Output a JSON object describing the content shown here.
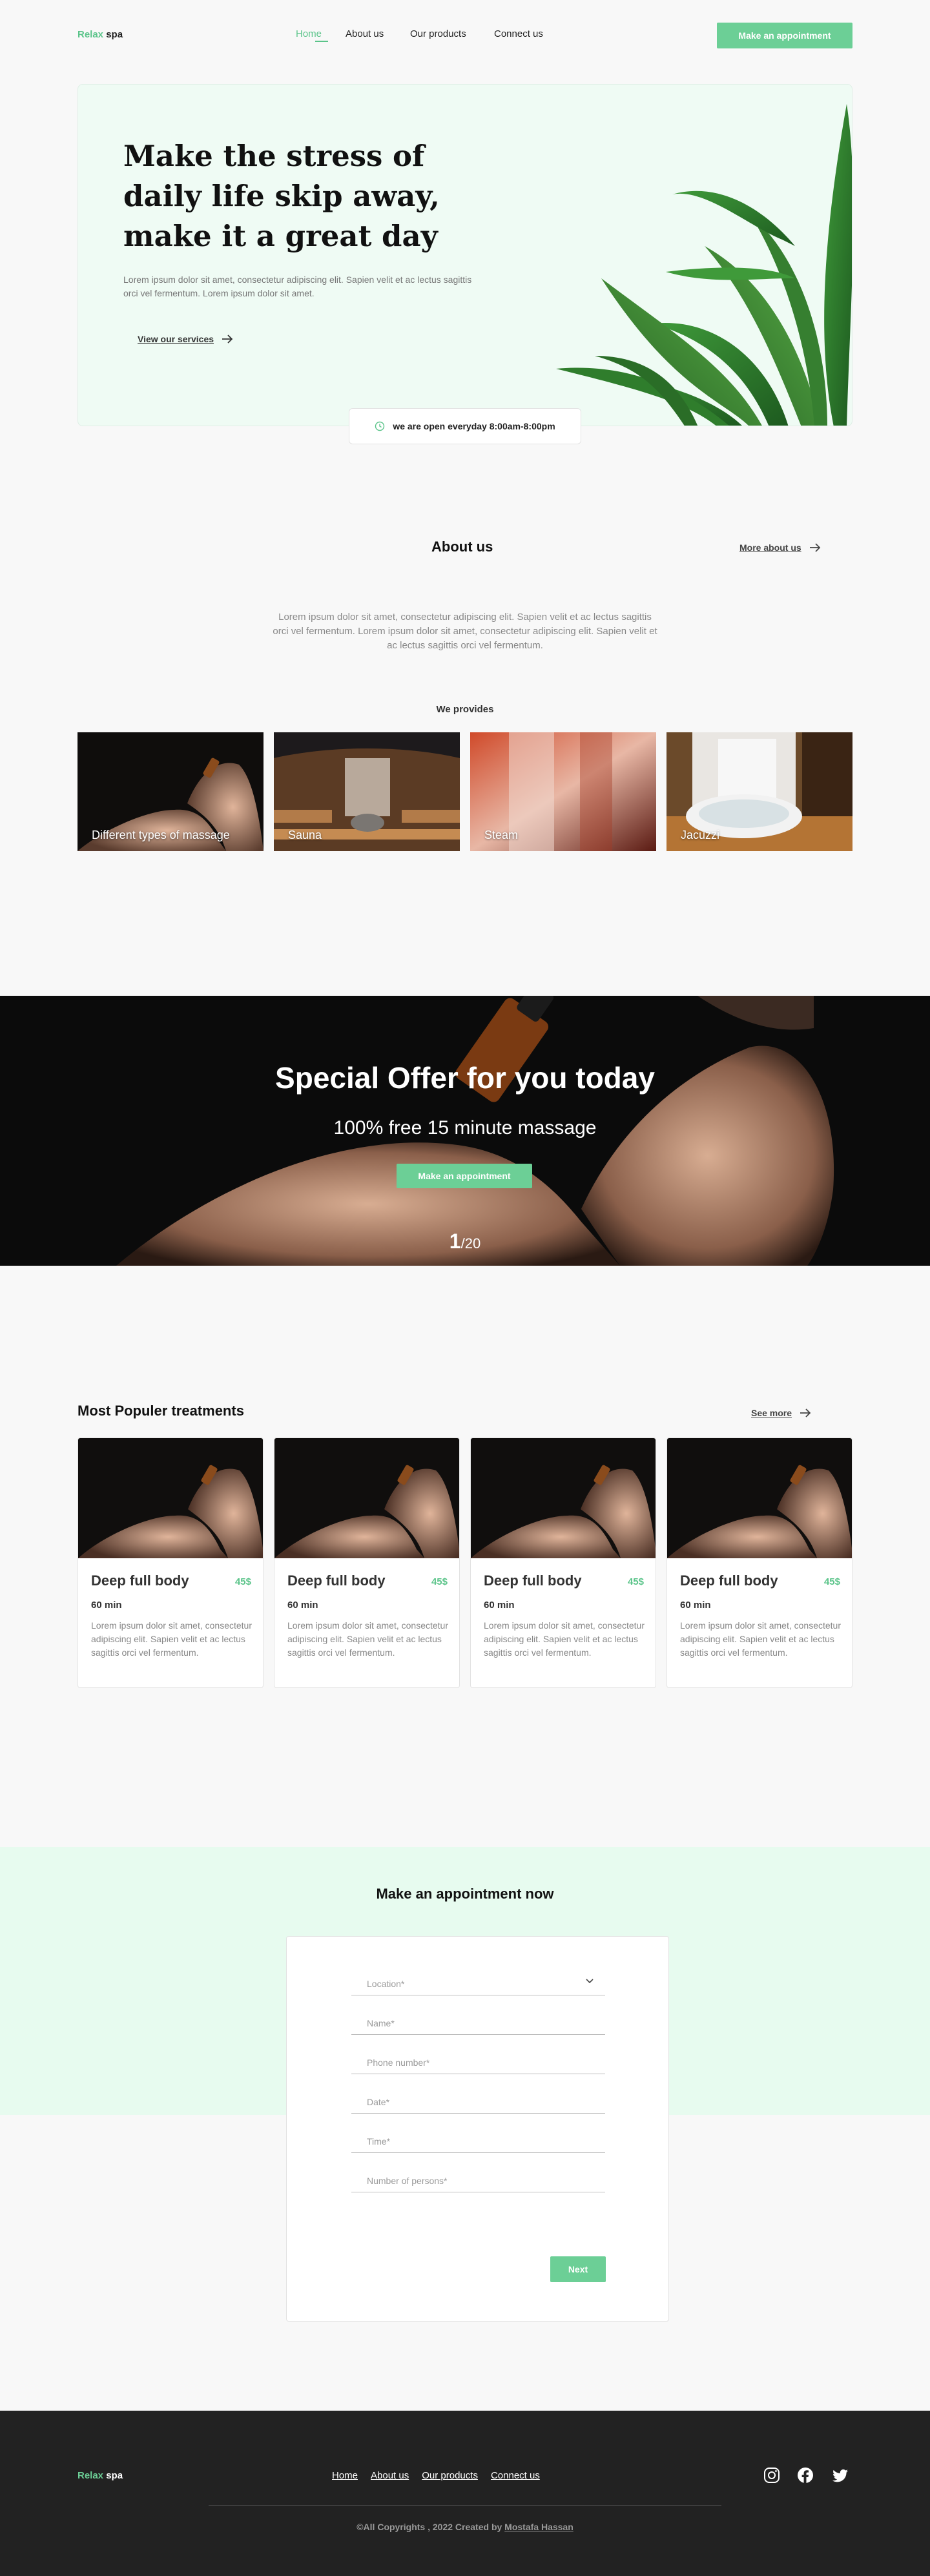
{
  "brand": {
    "accent": "Relax",
    "name": " spa",
    "accent_color": "#5bc48a"
  },
  "nav": {
    "items": [
      {
        "label": "Home",
        "active": true
      },
      {
        "label": "About us"
      },
      {
        "label": "Our products"
      },
      {
        "label": "Connect us"
      }
    ],
    "cta": "Make an appointment"
  },
  "hero": {
    "title": "Make the stress of daily life skip away, make it a great day",
    "text": "Lorem ipsum dolor sit amet, consectetur adipiscing elit. Sapien velit et ac lectus sagittis orci vel fermentum. Lorem ipsum dolor sit amet.",
    "link": "View our services",
    "hours": "we are open everyday 8:00am-8:00pm"
  },
  "about": {
    "title": "About us",
    "more": "More about us",
    "text": "Lorem ipsum dolor sit amet, consectetur adipiscing elit. Sapien velit et ac lectus sagittis orci vel fermentum. Lorem ipsum dolor sit amet, consectetur adipiscing elit. Sapien velit et ac lectus sagittis orci vel fermentum.",
    "provides_title": "We provides",
    "services": [
      {
        "label": "Different types of massage"
      },
      {
        "label": "Sauna"
      },
      {
        "label": "Steam"
      },
      {
        "label": "Jacuzzi"
      }
    ]
  },
  "offer": {
    "title": "Special Offer for you today",
    "subtitle": "100% free 15 minute massage",
    "cta": "Make an appointment",
    "page_current": "1",
    "page_total": "/20"
  },
  "treatments": {
    "title": "Most Populer treatments",
    "more": "See more",
    "cards": [
      {
        "name": "Deep full body",
        "price": "45$",
        "duration": "60 min",
        "desc": "Lorem ipsum dolor sit amet, consectetur adipiscing elit. Sapien velit et ac lectus sagittis orci vel fermentum."
      },
      {
        "name": "Deep full body",
        "price": "45$",
        "duration": "60 min",
        "desc": "Lorem ipsum dolor sit amet, consectetur adipiscing elit. Sapien velit et ac lectus sagittis orci vel fermentum."
      },
      {
        "name": "Deep full body",
        "price": "45$",
        "duration": "60 min",
        "desc": "Lorem ipsum dolor sit amet, consectetur adipiscing elit. Sapien velit et ac lectus sagittis orci vel fermentum."
      },
      {
        "name": "Deep full body",
        "price": "45$",
        "duration": "60 min",
        "desc": "Lorem ipsum dolor sit amet, consectetur adipiscing elit. Sapien velit et ac lectus sagittis orci vel fermentum."
      }
    ]
  },
  "appointment": {
    "title": "Make an appointment now",
    "fields": {
      "location": "Location*",
      "name": "Name*",
      "phone": "Phone number*",
      "date": "Date*",
      "time": "Time*",
      "persons": "Number of persons*"
    },
    "next": "Next"
  },
  "footer": {
    "links": [
      "Home",
      "About us",
      "Our products",
      "Connect us"
    ],
    "copyright": "©All Copyrights , 2022 Created by ",
    "author": "Mostafa Hassan",
    "social": [
      "instagram-icon",
      "facebook-icon",
      "twitter-icon"
    ]
  }
}
